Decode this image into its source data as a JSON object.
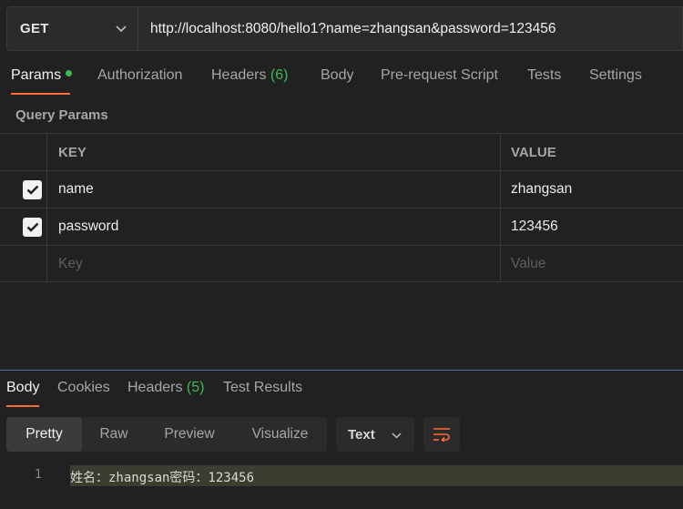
{
  "request": {
    "method": "GET",
    "url": "http://localhost:8080/hello1?name=zhangsan&password=123456"
  },
  "request_tabs": [
    {
      "label": "Params",
      "active": true
    },
    {
      "label": "Authorization"
    },
    {
      "label": "Headers ",
      "count": "(6)"
    },
    {
      "label": "Body"
    },
    {
      "label": "Pre-request Script"
    },
    {
      "label": "Tests"
    },
    {
      "label": "Settings"
    }
  ],
  "query_params": {
    "title": "Query Params",
    "headers": {
      "key": "KEY",
      "value": "VALUE"
    },
    "rows": [
      {
        "checked": true,
        "key": "name",
        "value": "zhangsan"
      },
      {
        "checked": true,
        "key": "password",
        "value": "123456"
      }
    ],
    "placeholder": {
      "key": "Key",
      "value": "Value"
    }
  },
  "response_tabs": [
    {
      "label": "Body",
      "active": true
    },
    {
      "label": "Cookies"
    },
    {
      "label": "Headers ",
      "count": "(5)"
    },
    {
      "label": "Test Results"
    }
  ],
  "view_modes": [
    "Pretty",
    "Raw",
    "Preview",
    "Visualize"
  ],
  "selected_view": "Pretty",
  "format": "Text",
  "response_body": {
    "line_number": "1",
    "text": "姓名：zhangsan密码：123456"
  },
  "colors": {
    "accent": "#ff6c37",
    "count_green": "#3fb950",
    "background": "#212121"
  }
}
